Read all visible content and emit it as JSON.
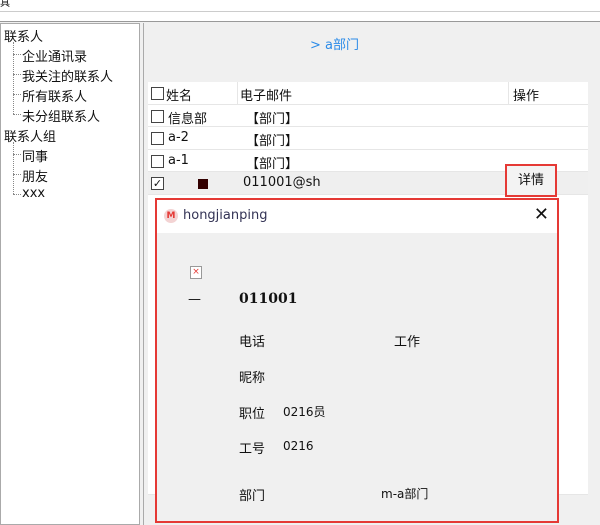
{
  "window": {
    "title_fragment": "具"
  },
  "sidebar": {
    "groups": [
      {
        "label": "联系人",
        "items": [
          "企业通讯录",
          "我关注的联系人",
          "所有联系人",
          "未分组联系人"
        ]
      },
      {
        "label": "联系人组",
        "items": [
          "同事",
          "朋友",
          "xxx"
        ]
      }
    ]
  },
  "main": {
    "breadcrumb": "> a部门",
    "table": {
      "headers": [
        "姓名",
        "电子邮件",
        "操作"
      ],
      "rows": [
        {
          "name": "信息部",
          "email": "【部门】",
          "checked": false
        },
        {
          "name": "a-2",
          "email": "【部门】",
          "checked": false
        },
        {
          "name": "a-1",
          "email": "【部门】",
          "checked": false
        },
        {
          "name": "",
          "email": "011001@sh",
          "checked": true,
          "action": "详情"
        }
      ]
    }
  },
  "dialog": {
    "title": "hongjianping",
    "dash": "—",
    "user_id": "011001",
    "fields": {
      "phone_label": "电话",
      "work_label": "工作",
      "nickname_label": "昵称",
      "position_label": "职位",
      "position_value": "0216员",
      "number_label": "工号",
      "number_value": "0216",
      "dept_label": "部门",
      "dept_value": "m-a部门"
    }
  }
}
